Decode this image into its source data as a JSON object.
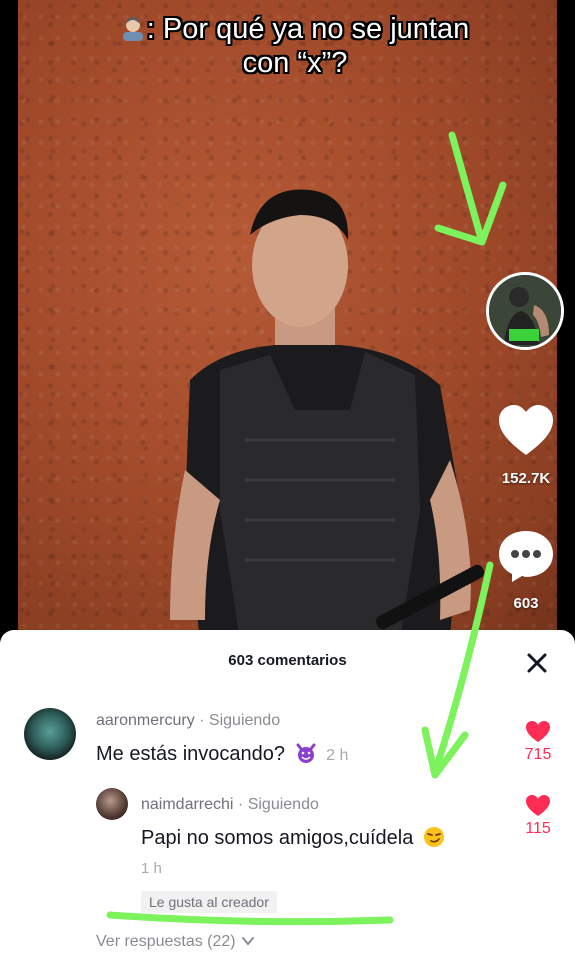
{
  "video": {
    "caption_line1": ": Por qué ya no se juntan",
    "caption_line2": "con “x”?",
    "likes": "152.7K",
    "comments": "603"
  },
  "sheet": {
    "title": "603 comentarios",
    "close_icon": "close-icon"
  },
  "comments": [
    {
      "username": "aaronmercury",
      "relation": " · Siguiendo",
      "text": "Me estás invocando?",
      "emoji": "smiling-devil-emoji",
      "time": "2 h",
      "likes": "715"
    },
    {
      "username": "naimdarrechi",
      "relation": " · Siguiendo",
      "text": "Papi no somos amigos,cuídela",
      "emoji": "smirking-face-emoji",
      "time": "1 h",
      "likes": "115",
      "badge": "Le gusta al creador"
    }
  ],
  "replies_link": "Ver respuestas (22)",
  "colors": {
    "like_red": "#fe2c55",
    "annotation_green": "#7cf25c",
    "wall": "#a24b2b"
  }
}
